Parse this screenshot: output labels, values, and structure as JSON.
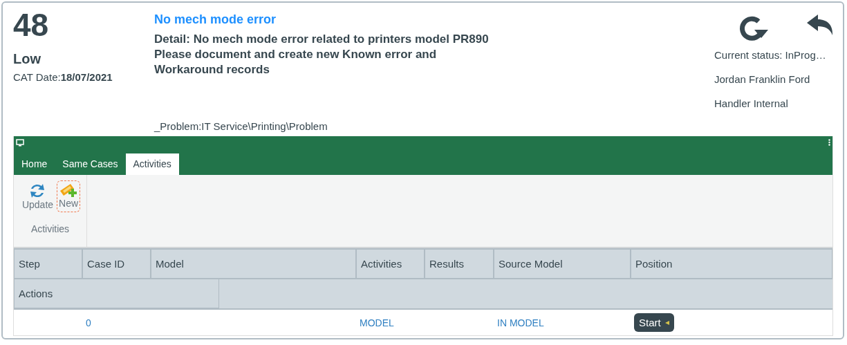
{
  "case": {
    "number": "48",
    "priority": "Low",
    "date_label": "CAT Date:",
    "date": "18/07/2021"
  },
  "problem": {
    "title": "No mech mode error",
    "detail": [
      "Detail: No mech mode error related to printers model PR890",
      "Please document and create new Known error and",
      "Workaround records"
    ],
    "category": "_Problem:IT Service\\Printing\\Problem"
  },
  "status": {
    "lines": [
      "Current status: InProg…",
      "Jordan Franklin Ford",
      "Handler Internal"
    ]
  },
  "tabs": [
    {
      "label": "Home",
      "selected": false
    },
    {
      "label": "Same Cases",
      "selected": false
    },
    {
      "label": "Activities",
      "selected": true
    }
  ],
  "ribbon": {
    "buttons": [
      {
        "label": "Update",
        "kind": "update",
        "focused": false
      },
      {
        "label": "New",
        "kind": "new",
        "focused": true
      }
    ],
    "group_label": "Activities"
  },
  "table": {
    "columns": [
      "Step",
      "Case ID",
      "Model",
      "Activities",
      "Results",
      "Source Model",
      "Position"
    ],
    "columns_row2": [
      "Actions"
    ],
    "rows": [
      {
        "step": "",
        "case_id": "0",
        "model": "",
        "activities": "MODEL",
        "results": "",
        "source_model": "IN MODEL",
        "position": "Start"
      }
    ]
  }
}
